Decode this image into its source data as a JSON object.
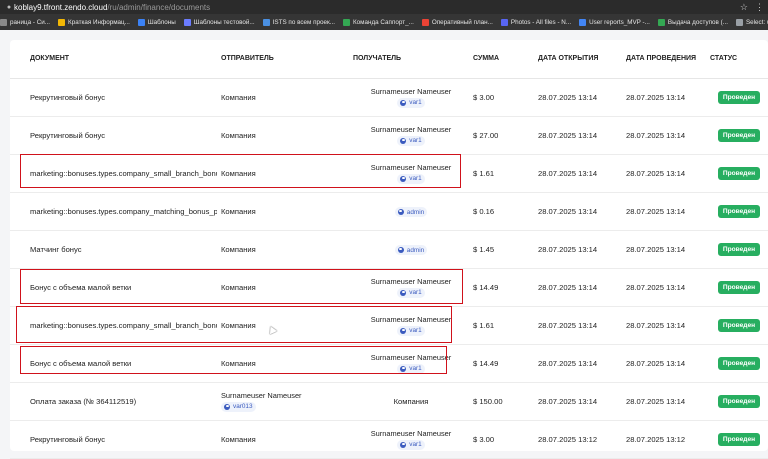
{
  "browser": {
    "url_host": "koblay9.tfront.zendo.cloud",
    "url_path": "/ru/admin/finance/documents",
    "bookmarks": [
      {
        "label": "раница - Си...",
        "color": "#8a8a8a"
      },
      {
        "label": "Краткая Информац...",
        "color": "#f2b705"
      },
      {
        "label": "Шаблоны",
        "color": "#3b82f6"
      },
      {
        "label": "Шаблоны тестовой...",
        "color": "#6b7cff"
      },
      {
        "label": "ISTS по всем проек...",
        "color": "#4a90e2"
      },
      {
        "label": "Команда Саппорт_...",
        "color": "#34a853"
      },
      {
        "label": "Оперативный план...",
        "color": "#ea4335"
      },
      {
        "label": "Photos - All files - N...",
        "color": "#5865f2"
      },
      {
        "label": "User reports_MVP -...",
        "color": "#4285f4"
      },
      {
        "label": "Выдача доступов (...",
        "color": "#34a853"
      },
      {
        "label": "Select: user_closure...",
        "color": "#9aa0a6"
      }
    ]
  },
  "table": {
    "headers": {
      "document": "ДОКУМЕНТ",
      "sender": "ОТПРАВИТЕЛЬ",
      "recipient": "ПОЛУЧАТЕЛЬ",
      "amount": "СУММА",
      "opened": "ДАТА ОТКРЫТИЯ",
      "posted": "ДАТА ПРОВЕДЕНИЯ",
      "status": "СТАТУС"
    },
    "rows": [
      {
        "document": "Рекрутинговый бонус",
        "sender": "Компания",
        "recipient_name": "Surnameuser Nameuser",
        "recipient_login": "var1",
        "amount": "$ 3.00",
        "opened": "28.07.2025 13:14",
        "posted": "28.07.2025 13:14",
        "status": "Проведен"
      },
      {
        "document": "Рекрутинговый бонус",
        "sender": "Компания",
        "recipient_name": "Surnameuser Nameuser",
        "recipient_login": "var1",
        "amount": "$ 27.00",
        "opened": "28.07.2025 13:14",
        "posted": "28.07.2025 13:14",
        "status": "Проведен"
      },
      {
        "document": "marketing::bonuses.types.company_small_branch_bonus",
        "sender": "Компания",
        "recipient_name": "Surnameuser Nameuser",
        "recipient_login": "var1",
        "amount": "$ 1.61",
        "opened": "28.07.2025 13:14",
        "posted": "28.07.2025 13:14",
        "status": "Проведен"
      },
      {
        "document": "marketing::bonuses.types.company_matching_bonus_pa",
        "sender": "Компания",
        "recipient_name": "",
        "recipient_login": "admin",
        "amount": "$ 0.16",
        "opened": "28.07.2025 13:14",
        "posted": "28.07.2025 13:14",
        "status": "Проведен"
      },
      {
        "document": "Матчинг бонус",
        "sender": "Компания",
        "recipient_name": "",
        "recipient_login": "admin",
        "amount": "$ 1.45",
        "opened": "28.07.2025 13:14",
        "posted": "28.07.2025 13:14",
        "status": "Проведен"
      },
      {
        "document": "Бонус с объема малой ветки",
        "sender": "Компания",
        "recipient_name": "Surnameuser Nameuser",
        "recipient_login": "var1",
        "amount": "$ 14.49",
        "opened": "28.07.2025 13:14",
        "posted": "28.07.2025 13:14",
        "status": "Проведен"
      },
      {
        "document": "marketing::bonuses.types.company_small_branch_bonus",
        "sender": "Компания",
        "recipient_name": "Surnameuser Nameuser",
        "recipient_login": "var1",
        "amount": "$ 1.61",
        "opened": "28.07.2025 13:14",
        "posted": "28.07.2025 13:14",
        "status": "Проведен"
      },
      {
        "document": "Бонус с объема малой ветки",
        "sender": "Компания",
        "recipient_name": "Surnameuser Nameuser",
        "recipient_login": "var1",
        "amount": "$ 14.49",
        "opened": "28.07.2025 13:14",
        "posted": "28.07.2025 13:14",
        "status": "Проведен"
      },
      {
        "document": "Оплата заказа (№ 364112519)",
        "sender_name": "Surnameuser Nameuser",
        "sender_login": "var013",
        "recipient_text": "Компания",
        "amount": "$ 150.00",
        "opened": "28.07.2025 13:14",
        "posted": "28.07.2025 13:14",
        "status": "Проведен"
      },
      {
        "document": "Рекрутинговый бонус",
        "sender": "Компания",
        "recipient_name": "Surnameuser Nameuser",
        "recipient_login": "var1",
        "amount": "$ 3.00",
        "opened": "28.07.2025 13:12",
        "posted": "28.07.2025 13:12",
        "status": "Проведен"
      }
    ]
  },
  "colors": {
    "status_green": "#27ae60",
    "highlight_red": "#d0121b",
    "badge_blue": "#3b5bbf"
  }
}
